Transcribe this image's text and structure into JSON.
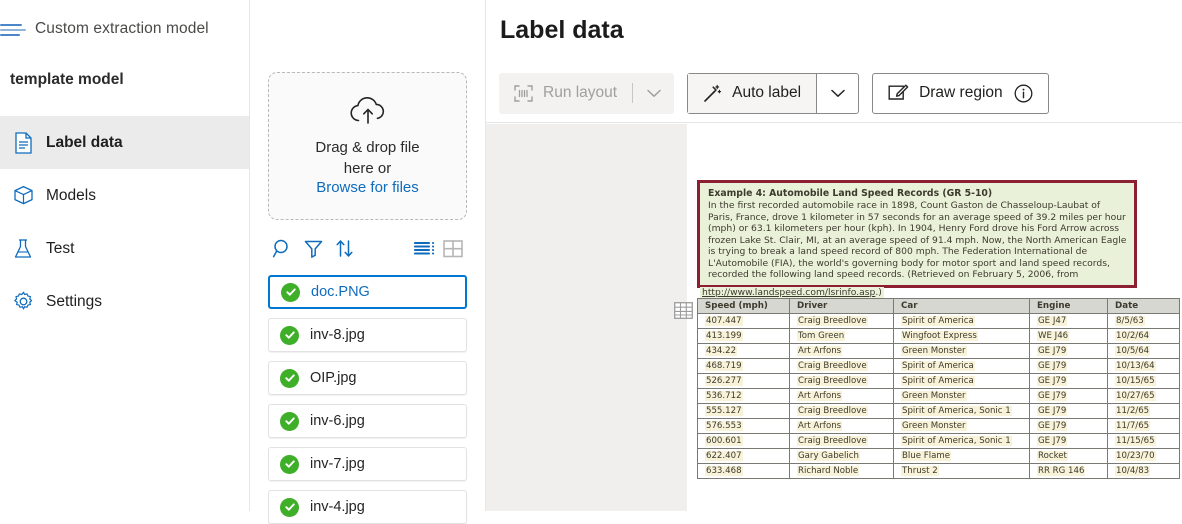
{
  "sidebar": {
    "brand_label": "Custom extraction model",
    "model_name": "template model",
    "items": [
      {
        "label": "Label data",
        "icon": "document-icon",
        "active": true
      },
      {
        "label": "Models",
        "icon": "box-icon",
        "active": false
      },
      {
        "label": "Test",
        "icon": "flask-icon",
        "active": false
      },
      {
        "label": "Settings",
        "icon": "gear-icon",
        "active": false
      }
    ]
  },
  "file_panel": {
    "dropzone_line1": "Drag & drop file",
    "dropzone_line2": "here or",
    "dropzone_link": "Browse for files",
    "tools": [
      "search-icon",
      "filter-icon",
      "sort-icon",
      "list-view-icon",
      "grid-view-icon"
    ],
    "files": [
      {
        "name": "doc.PNG",
        "status": "complete",
        "selected": true
      },
      {
        "name": "inv-8.jpg",
        "status": "complete",
        "selected": false
      },
      {
        "name": "OIP.jpg",
        "status": "complete",
        "selected": false
      },
      {
        "name": "inv-6.jpg",
        "status": "complete",
        "selected": false
      },
      {
        "name": "inv-7.jpg",
        "status": "complete",
        "selected": false
      },
      {
        "name": "inv-4.jpg",
        "status": "complete",
        "selected": false
      }
    ]
  },
  "main": {
    "page_title": "Label data",
    "toolbar": {
      "run_layout_label": "Run layout",
      "auto_label_label": "Auto label",
      "draw_region_label": "Draw region"
    }
  },
  "document": {
    "paragraph_title": "Example 4: Automobile Land Speed Records (GR 5-10)",
    "paragraph_body": "In the first recorded automobile race in 1898, Count Gaston de Chasseloup-Laubat of Paris, France, drove 1 kilometer in 57 seconds for an average speed of 39.2 miles per hour (mph) or 63.1 kilometers per hour (kph). In 1904, Henry Ford drove his Ford Arrow across frozen Lake St. Clair, MI, at an average speed of 91.4 mph. Now, the North American Eagle is trying to break a land speed record of 800 mph. The Federation International de L'Automobile (FIA), the world's governing body for motor sport and land speed records, recorded the following land speed records. (Retrieved on February 5, 2006, from",
    "paragraph_url": "http://www.landspeed.com/lsrinfo.asp",
    "paragraph_tail": ".)",
    "table": {
      "headers": [
        "Speed (mph)",
        "Driver",
        "Car",
        "Engine",
        "Date"
      ],
      "rows": [
        [
          "407.447",
          "Craig Breedlove",
          "Spirit of America",
          "GE J47",
          "8/5/63"
        ],
        [
          "413.199",
          "Tom Green",
          "Wingfoot Express",
          "WE J46",
          "10/2/64"
        ],
        [
          "434.22",
          "Art Arfons",
          "Green Monster",
          "GE J79",
          "10/5/64"
        ],
        [
          "468.719",
          "Craig Breedlove",
          "Spirit of America",
          "GE J79",
          "10/13/64"
        ],
        [
          "526.277",
          "Craig Breedlove",
          "Spirit of America",
          "GE J79",
          "10/15/65"
        ],
        [
          "536.712",
          "Art Arfons",
          "Green Monster",
          "GE J79",
          "10/27/65"
        ],
        [
          "555.127",
          "Craig Breedlove",
          "Spirit of America, Sonic 1",
          "GE J79",
          "11/2/65"
        ],
        [
          "576.553",
          "Art Arfons",
          "Green Monster",
          "GE J79",
          "11/7/65"
        ],
        [
          "600.601",
          "Craig Breedlove",
          "Spirit of America, Sonic 1",
          "GE J79",
          "11/15/65"
        ],
        [
          "622.407",
          "Gary Gabelich",
          "Blue Flame",
          "Rocket",
          "10/23/70"
        ],
        [
          "633.468",
          "Richard Noble",
          "Thrust 2",
          "RR RG 146",
          "10/4/83"
        ]
      ]
    }
  },
  "colors": {
    "accent": "#0078d4",
    "link": "#0f6cbd",
    "success": "#3fae29",
    "region_border": "#8d1f32",
    "highlight_text": "#eaf1d9",
    "highlight_cell": "#f8f3d8"
  }
}
